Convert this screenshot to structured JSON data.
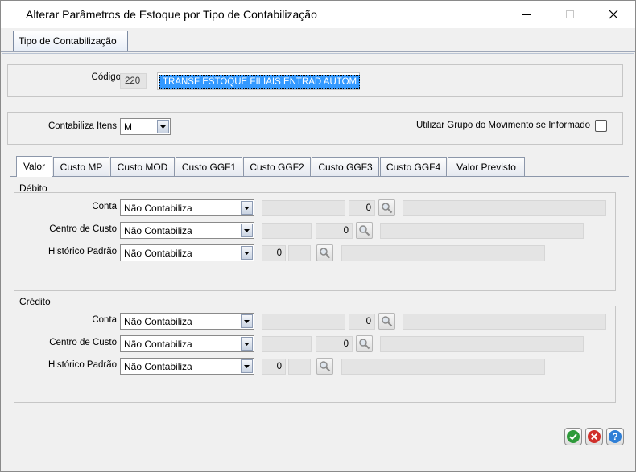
{
  "window": {
    "title": "Alterar Parâmetros de Estoque por Tipo de Contabilização"
  },
  "top_tab": {
    "label": "Tipo de Contabilização"
  },
  "header": {
    "codigo_label": "Código",
    "codigo_value": "220",
    "descricao_value": "TRANSF ESTOQUE FILIAIS ENTRAD AUTOM"
  },
  "options": {
    "contabiliza_itens_label": "Contabiliza Itens",
    "contabiliza_itens_value": "M",
    "utilizar_grupo_label": "Utilizar Grupo do Movimento se Informado",
    "utilizar_grupo_checked": false
  },
  "subtabs": [
    "Valor",
    "Custo MP",
    "Custo MOD",
    "Custo GGF1",
    "Custo GGF2",
    "Custo GGF3",
    "Custo GGF4",
    "Valor Previsto"
  ],
  "active_subtab": "Valor",
  "debito": {
    "title": "Débito",
    "conta_label": "Conta",
    "conta_select": "Não Contabiliza",
    "conta_num": "0",
    "centro_label": "Centro de Custo",
    "centro_select": "Não Contabiliza",
    "centro_num": "0",
    "historico_label": "Histórico Padrão",
    "historico_select": "Não Contabiliza",
    "historico_num": "0"
  },
  "credito": {
    "title": "Crédito",
    "conta_label": "Conta",
    "conta_select": "Não Contabiliza",
    "conta_num": "0",
    "centro_label": "Centro de Custo",
    "centro_select": "Não Contabiliza",
    "centro_num": "0",
    "historico_label": "Histórico Padrão",
    "historico_select": "Não Contabiliza",
    "historico_num": "0"
  },
  "icons": {
    "confirm": "check-circle-icon",
    "cancel": "x-circle-icon",
    "help": "question-circle-icon",
    "lookup": "magnifier-icon"
  },
  "colors": {
    "confirm": "#2e9a3a",
    "cancel": "#d0302b",
    "help": "#2f7fd6",
    "selection": "#3399ff"
  }
}
